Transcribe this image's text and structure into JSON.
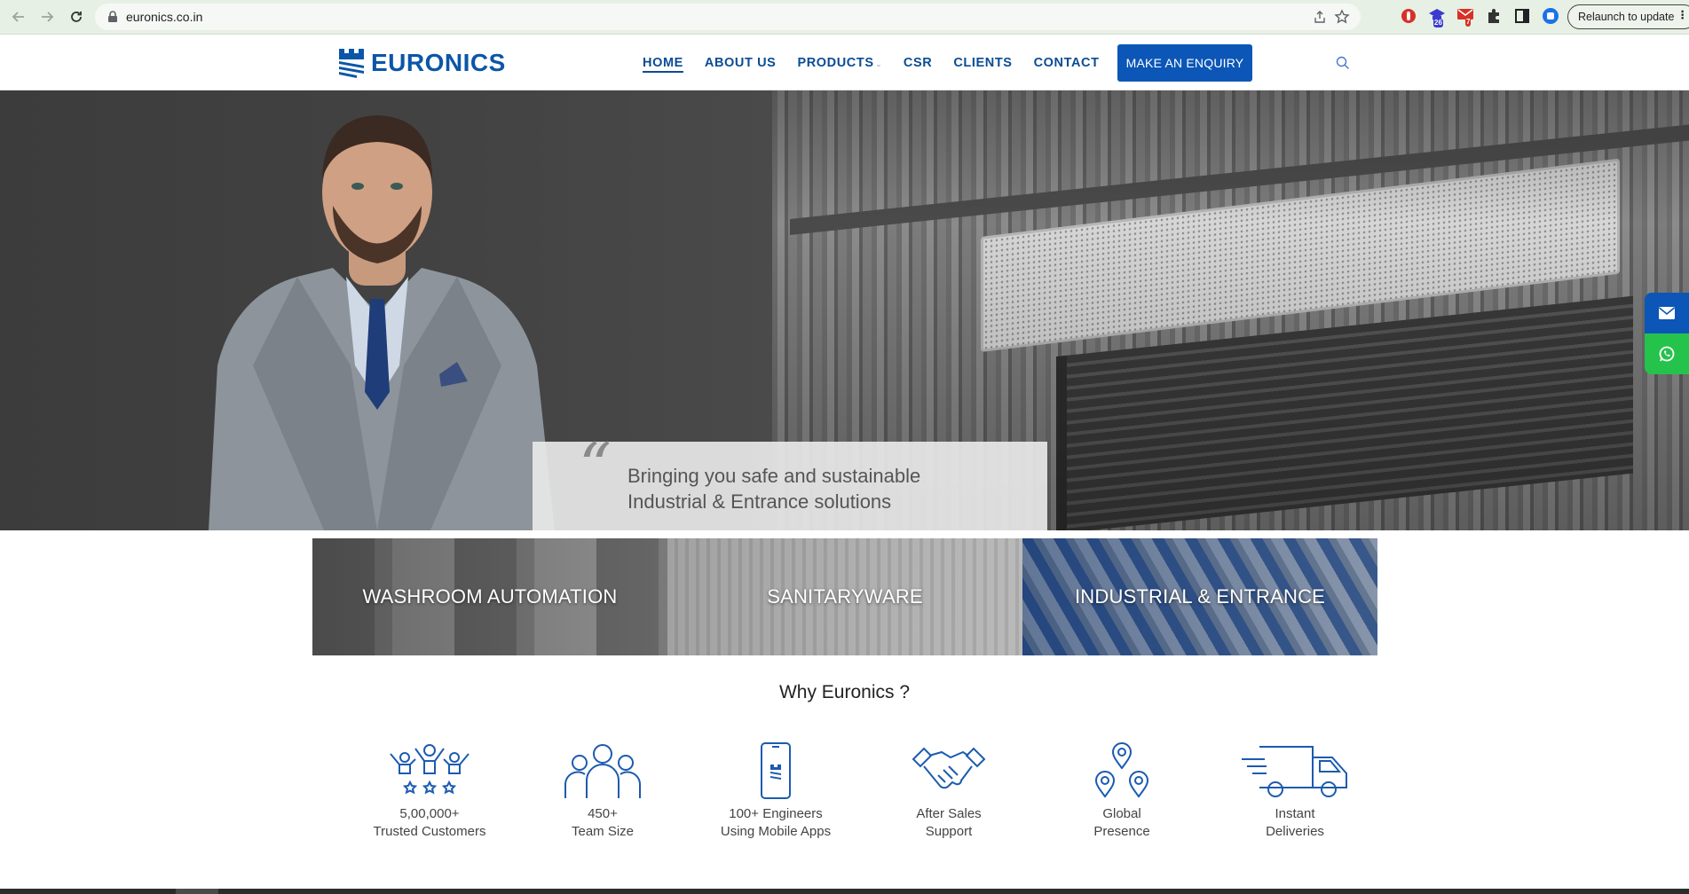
{
  "browser": {
    "url": "euronics.co.in",
    "relaunch_label": "Relaunch to update",
    "extensions": [
      {
        "name": "adblock-icon",
        "color": "#d93025"
      },
      {
        "name": "graduation-cap-icon",
        "badge": "26",
        "color": "#3b3bd1"
      },
      {
        "name": "gmail-icon",
        "badge": "7",
        "color": "#d93025"
      },
      {
        "name": "puzzle-icon"
      },
      {
        "name": "sidepanel-icon"
      },
      {
        "name": "profile-icon",
        "color": "#1a73e8"
      }
    ]
  },
  "header": {
    "logo_text": "EURONICS",
    "nav": [
      {
        "label": "HOME",
        "active": true
      },
      {
        "label": "ABOUT US"
      },
      {
        "label": "PRODUCTS",
        "has_dropdown": true
      },
      {
        "label": "CSR"
      },
      {
        "label": "CLIENTS"
      },
      {
        "label": "CONTACT"
      }
    ],
    "cta_label": "MAKE AN ENQUIRY",
    "brand_color": "#0b56b7"
  },
  "hero": {
    "tagline_line1": "Bringing you safe and sustainable",
    "tagline_line2": "Industrial & Entrance solutions"
  },
  "categories": [
    {
      "label": "WASHROOM AUTOMATION"
    },
    {
      "label": "SANITARYWARE"
    },
    {
      "label": "INDUSTRIAL & ENTRANCE"
    }
  ],
  "why": {
    "title": "Why Euronics ?",
    "features": [
      {
        "icon": "celebrating-people-icon",
        "line1": "5,00,000+",
        "line2": "Trusted Customers"
      },
      {
        "icon": "team-icon",
        "line1": "450+",
        "line2": "Team Size"
      },
      {
        "icon": "mobile-app-icon",
        "line1": "100+ Engineers",
        "line2": "Using Mobile Apps"
      },
      {
        "icon": "handshake-icon",
        "line1": "After Sales",
        "line2": "Support"
      },
      {
        "icon": "location-pins-icon",
        "line1": "Global",
        "line2": "Presence"
      },
      {
        "icon": "delivery-truck-icon",
        "line1": "Instant",
        "line2": "Deliveries"
      }
    ]
  },
  "floating": {
    "mail_color": "#0b56b7",
    "whatsapp_color": "#25c34b"
  }
}
